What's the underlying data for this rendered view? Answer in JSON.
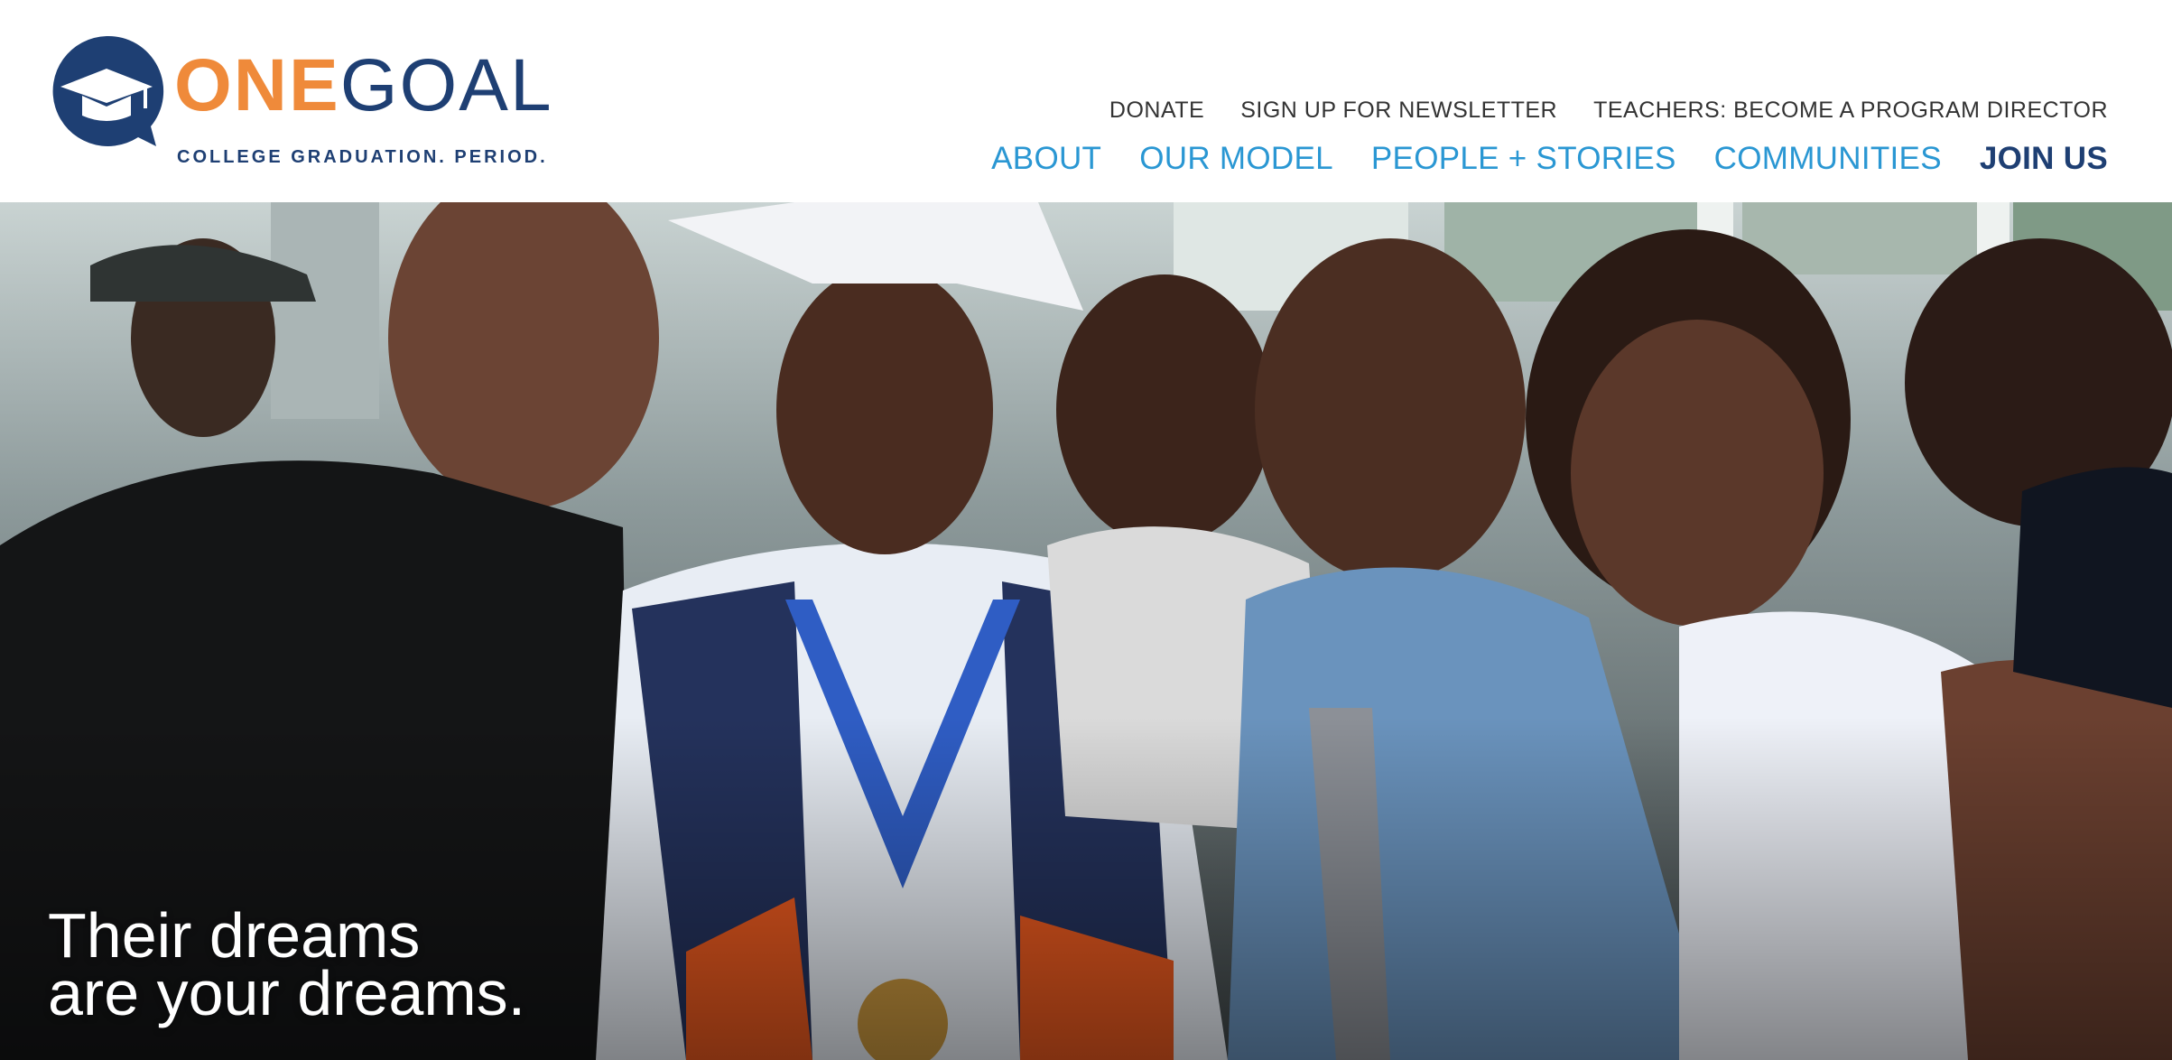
{
  "brand": {
    "one": "ONE",
    "goal": "GOAL",
    "tagline": "COLLEGE GRADUATION. PERIOD.",
    "colors": {
      "orange": "#ef8a3a",
      "navy": "#1e3f73",
      "blue": "#2a97d3"
    }
  },
  "utility_nav": [
    {
      "label": "DONATE"
    },
    {
      "label": "SIGN UP FOR NEWSLETTER"
    },
    {
      "label": "TEACHERS: BECOME A PROGRAM DIRECTOR"
    }
  ],
  "main_nav": [
    {
      "label": "ABOUT"
    },
    {
      "label": "OUR MODEL"
    },
    {
      "label": "PEOPLE + STORIES"
    },
    {
      "label": "COMMUNITIES"
    },
    {
      "label": "JOIN US"
    }
  ],
  "hero": {
    "line1": "Their dreams",
    "line2": "are your dreams."
  }
}
